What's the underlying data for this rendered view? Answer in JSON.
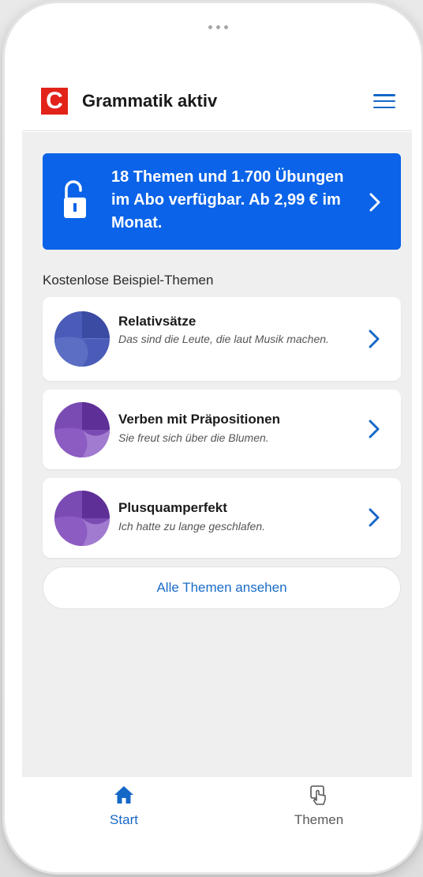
{
  "app": {
    "title": "Grammatik aktiv",
    "logo_letter": "C",
    "brand_color": "#e2231a",
    "accent_color": "#1668c7"
  },
  "promo": {
    "text": "18 Themen und 1.700 Übungen im Abo verfügbar. Ab 2,99 € im Monat.",
    "icon": "unlocked-padlock-icon",
    "background": "#0a63e8"
  },
  "section": {
    "title": "Kostenlose Beispiel-Themen"
  },
  "topics": [
    {
      "title": "Relativsätze",
      "description": "Das sind die Leute, die laut Musik machen.",
      "icon": "blue-circle-icon"
    },
    {
      "title": "Verben mit Präpositionen",
      "description": "Sie freut sich über die Blumen.",
      "icon": "purple-circle-icon"
    },
    {
      "title": "Plusquamperfekt",
      "description": "Ich hatte zu lange geschlafen.",
      "icon": "purple-circle-icon"
    }
  ],
  "all_topics_label": "Alle Themen ansehen",
  "nav": {
    "items": [
      {
        "label": "Start",
        "icon": "home-icon",
        "active": true
      },
      {
        "label": "Themen",
        "icon": "tap-hand-icon",
        "active": false
      }
    ]
  }
}
